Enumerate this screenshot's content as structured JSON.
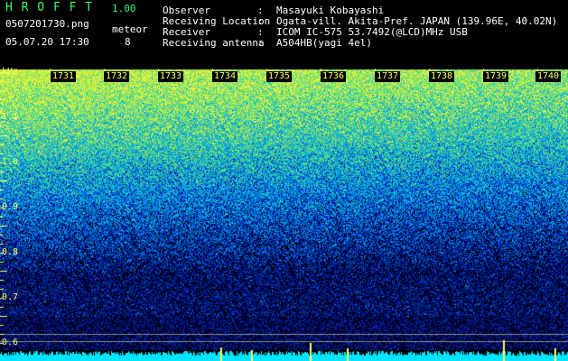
{
  "header": {
    "app_name": "H R O F F T",
    "version": "1.00",
    "filename": "0507201730.png",
    "datetime": "05.07.20 17:30",
    "meteor_label": "meteor",
    "meteor_count": "8",
    "info": [
      {
        "label": "Observer",
        "value": "Masayuki Kobayashi"
      },
      {
        "label": "Receiving Location",
        "value": "Ogata-vill. Akita-Pref. JAPAN (139.96E, 40.02N)"
      },
      {
        "label": "Receiver",
        "value": "ICOM IC-575 53.7492(@LCD)MHz USB"
      },
      {
        "label": "Receiving antenna",
        "value": "A504HB(yagi 4el)"
      }
    ],
    "colon": ":"
  },
  "axis": {
    "unit": "kHz",
    "freq_ticks": [
      "1.1",
      "1.0",
      "0.9",
      "0.8",
      "0.7",
      "0.6"
    ],
    "time_ticks": [
      "1731",
      "1732",
      "1733",
      "1734",
      "1735",
      "1736",
      "1737",
      "1738",
      "1739",
      "1740"
    ]
  },
  "colors": {
    "background": "#000000",
    "header_text": "#ffffff",
    "title_green": "#33ff66",
    "axis_yellow": "#ffff66",
    "signal_cyan": "#00e5ff"
  }
}
